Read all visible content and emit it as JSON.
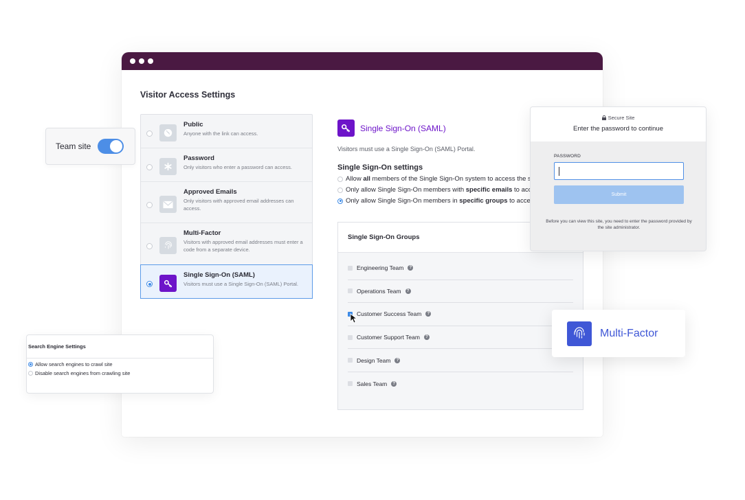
{
  "window": {
    "title": "Visitor Access Settings"
  },
  "access_options": [
    {
      "title": "Public",
      "description": "Anyone with the link can access.",
      "icon": "globe-icon",
      "selected": false
    },
    {
      "title": "Password",
      "description": "Only visitors who enter a password can access.",
      "icon": "asterisk-icon",
      "selected": false
    },
    {
      "title": "Approved Emails",
      "description": "Only visitors with approved email addresses can access.",
      "icon": "envelope-icon",
      "selected": false
    },
    {
      "title": "Multi-Factor",
      "description": "Visitors with approved email addresses must enter a code from a separate device.",
      "icon": "fingerprint-icon",
      "selected": false
    },
    {
      "title": "Single Sign-On (SAML)",
      "description": "Visitors must use a Single Sign-On (SAML) Portal.",
      "icon": "key-icon",
      "selected": true
    }
  ],
  "detail": {
    "title": "Single Sign-On (SAML)",
    "subtitle": "Visitors must use a Single Sign-On (SAML) Portal.",
    "settings_heading": "Single Sign-On settings",
    "settings_options": [
      {
        "pre": "Allow ",
        "bold": "all",
        "post": " members of the Single Sign-On system to access the s",
        "selected": false
      },
      {
        "pre": "Only allow Single Sign-On members with ",
        "bold": "specific emails",
        "post": " to acc",
        "selected": false
      },
      {
        "pre": "Only allow Single Sign-On members in ",
        "bold": "specific groups",
        "post": " to acces",
        "selected": true
      }
    ]
  },
  "groups": {
    "heading": "Single Sign-On Groups",
    "items": [
      {
        "label": "Engineering Team",
        "checked": false
      },
      {
        "label": "Operations Team",
        "checked": false
      },
      {
        "label": "Customer Success Team",
        "checked": true
      },
      {
        "label": "Customer Support Team",
        "checked": false
      },
      {
        "label": "Design Team",
        "checked": false
      },
      {
        "label": "Sales Team",
        "checked": false
      }
    ]
  },
  "team_site": {
    "label": "Team site",
    "enabled": true
  },
  "search_engine": {
    "heading": "Search Engine Settings",
    "options": [
      {
        "label": "Allow search engines to crawl site",
        "selected": true
      },
      {
        "label": "Disable search engines from crawling site",
        "selected": false
      }
    ]
  },
  "secure_site": {
    "tag": "Secure Site",
    "title": "Enter the password to continue",
    "password_label": "PASSWORD",
    "password_value": "",
    "submit_label": "Submit",
    "note": "Before you can view this site, you need to enter the password provided by the site administrator."
  },
  "multi_factor_badge": {
    "label": "Multi-Factor"
  },
  "colors": {
    "titlebar": "#4a1942",
    "saml_purple": "#6d14c9",
    "accent_blue": "#3d8ae6",
    "mf_blue": "#3f57d6"
  }
}
